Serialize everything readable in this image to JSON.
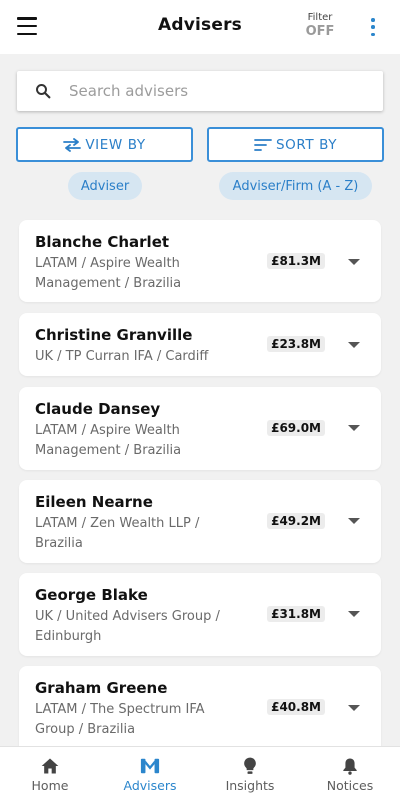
{
  "header": {
    "title": "Advisers",
    "filter_label": "Filter",
    "filter_value": "OFF"
  },
  "search": {
    "placeholder": "Search advisers",
    "value": ""
  },
  "controls": {
    "view_by_label": "VIEW BY",
    "sort_by_label": "SORT BY",
    "view_chip": "Adviser",
    "sort_chip": "Adviser/Firm (A - Z)"
  },
  "advisers": [
    {
      "name": "Blanche Charlet",
      "sub_line1": "LATAM / Aspire Wealth",
      "sub_line2": "Management / Brazilia",
      "amount": "£81.3M"
    },
    {
      "name": "Christine Granville",
      "sub_line1": "UK / TP Curran IFA / Cardiff",
      "sub_line2": "",
      "amount": "£23.8M"
    },
    {
      "name": "Claude Dansey",
      "sub_line1": "LATAM / Aspire Wealth",
      "sub_line2": "Management / Brazilia",
      "amount": "£69.0M"
    },
    {
      "name": "Eileen Nearne",
      "sub_line1": "LATAM / Zen Wealth LLP /",
      "sub_line2": "Brazilia",
      "amount": "£49.2M"
    },
    {
      "name": "George Blake",
      "sub_line1": "UK / United Advisers Group /",
      "sub_line2": "Edinburgh",
      "amount": "£31.8M"
    },
    {
      "name": "Graham Greene",
      "sub_line1": "LATAM / The Spectrum IFA",
      "sub_line2": "Group / Brazilia",
      "amount": "£40.8M"
    }
  ],
  "bottom_nav": {
    "items": [
      {
        "label": "Home",
        "icon": "home-icon",
        "active": false
      },
      {
        "label": "Advisers",
        "icon": "advisers-icon",
        "active": true
      },
      {
        "label": "Insights",
        "icon": "lightbulb-icon",
        "active": false
      },
      {
        "label": "Notices",
        "icon": "bell-icon",
        "active": false
      }
    ]
  },
  "colors": {
    "accent": "#2b86cc",
    "background": "#f1f1f1",
    "chip_bg": "#d6e6f2"
  }
}
